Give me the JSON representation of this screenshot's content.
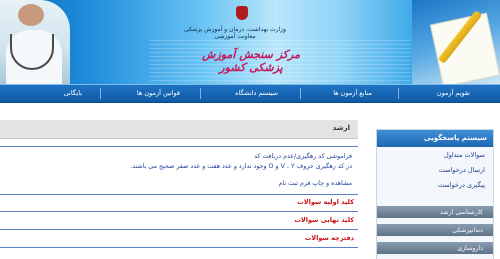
{
  "banner": {
    "ministry_line1": "وزارت بهداشت، درمان و آموزش پزشکی",
    "ministry_line2": "معاونت آموزشی",
    "center_title": "مرکز سنجش آموزش پزشکی کشور"
  },
  "nav": {
    "items": [
      "تقویم آزمون",
      "منابع آزمون ها",
      "سیستم دانشگاه",
      "قوانین آزمون ها",
      "بایگانی"
    ]
  },
  "main": {
    "header": "ارشد",
    "info_line1": "فراموشی کد رهگیری/عدم دریافت کد",
    "info_line2": "در کد رهگیری حروف V ، Y و O وجود ندارد و عدد هفت و عدد صفر صحیح می باشند.",
    "info_line3": "مشاهده و چاپ فرم ثبت نام",
    "links": [
      "کلید اولیه سوالات",
      "کلید نهایی سوالات",
      "دفترچه سوالات"
    ]
  },
  "sidebar": {
    "title": "سیستم پاسخگویی",
    "links": [
      "سوالات متداول",
      "ارسال درخواست",
      "پیگیری درخواست"
    ],
    "bars": [
      "کارشناسی ارشد",
      "دندانپزشکی",
      "داروسازی"
    ]
  },
  "colors": {
    "nav_bg": "#1668b8",
    "link_red": "#cc1010",
    "info_blue": "#1d3f9c",
    "sidebar_title_bg": "#2a78c4"
  }
}
